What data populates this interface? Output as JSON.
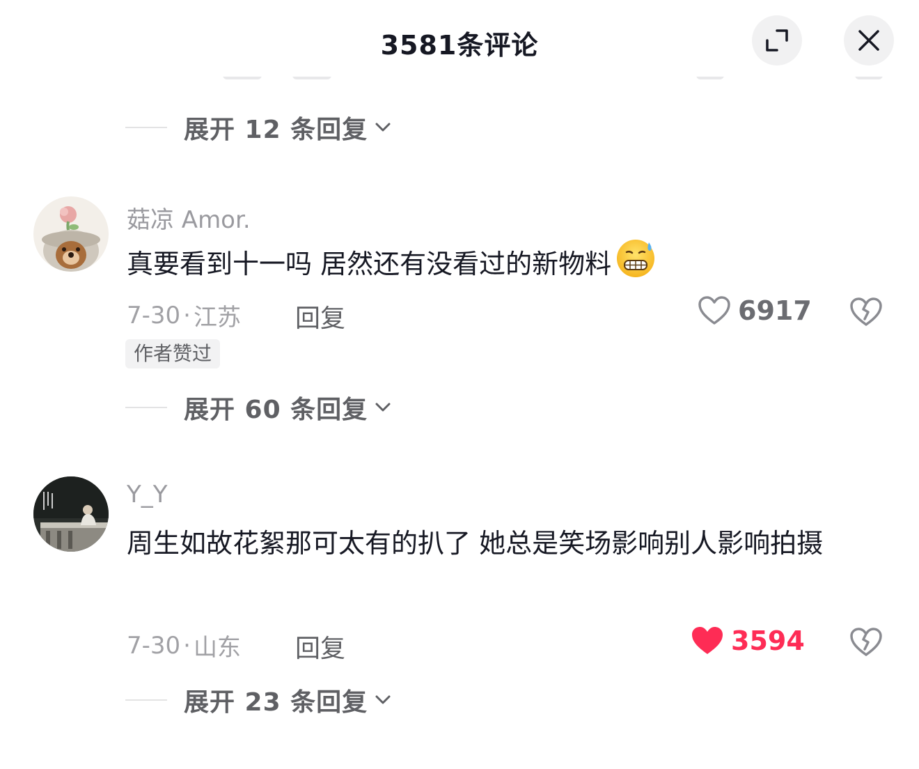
{
  "header": {
    "title": "3581条评论",
    "expand_icon": "expand-icon",
    "close_icon": "close-icon"
  },
  "colors": {
    "liked": "#fe2c55",
    "text": "#161823",
    "secondary": "#a1a1a5",
    "button_bg": "#f1f1f2"
  },
  "expand_rows": [
    {
      "label": "展开 12 条回复"
    },
    {
      "label": "展开 60 条回复"
    },
    {
      "label": "展开 23 条回复"
    }
  ],
  "comments": [
    {
      "username": "菇凉 Amor.",
      "text": "真要看到十一吗 居然还有没看过的新物料",
      "emoji": "grimacing-sweat-emoji",
      "date": "7-30",
      "location": "江苏",
      "reply_label": "回复",
      "likes": "6917",
      "liked": false,
      "badge": "作者赞过"
    },
    {
      "username": "Y_Y",
      "text": "周生如故花絮那可太有的扒了 她总是笑场影响别人影响拍摄",
      "date": "7-30",
      "location": "山东",
      "reply_label": "回复",
      "likes": "3594",
      "liked": true
    }
  ]
}
